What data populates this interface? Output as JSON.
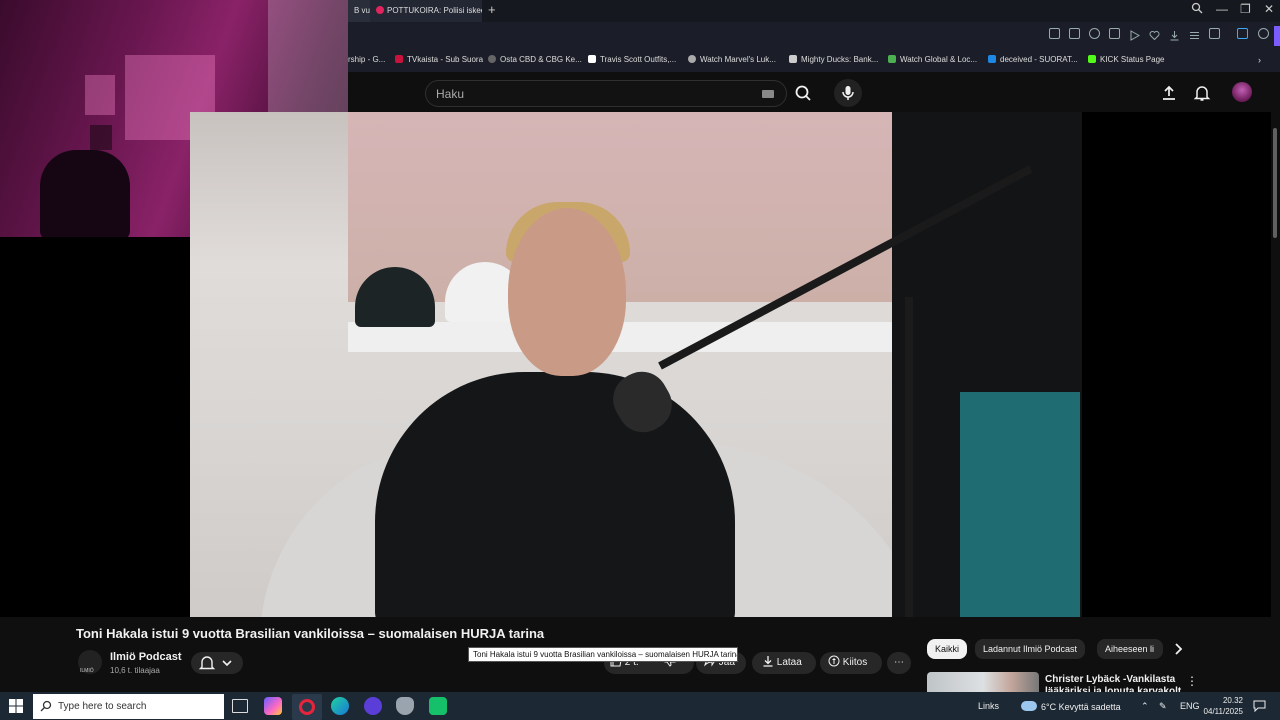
{
  "browser": {
    "tabs": [
      {
        "label": "B vu"
      },
      {
        "label": "POTTUKOIRA: Poliisi iskee"
      }
    ],
    "new_tab_label": "+",
    "window_controls": {
      "minimize": "—",
      "restore": "❐",
      "close": "✕"
    }
  },
  "bookmarks": [
    {
      "label": "rship - G..."
    },
    {
      "label": "TVkaista - Sub Suora",
      "color": "#c8143c"
    },
    {
      "label": "Osta CBD & CBG Ke...",
      "color": "#666666"
    },
    {
      "label": "Travis Scott Outfits,...",
      "color": "#ffffff"
    },
    {
      "label": "Watch Marvel's Luk...",
      "color": "#aaaaaa"
    },
    {
      "label": "Mighty Ducks: Bank...",
      "color": "#cccccc"
    },
    {
      "label": "Watch Global & Loc...",
      "color": "#4caf50"
    },
    {
      "label": "deceived - SUORAT...",
      "color": "#1e88e5"
    },
    {
      "label": "KICK Status Page",
      "color": "#53fc18"
    }
  ],
  "youtube": {
    "search_placeholder": "Haku",
    "icons": [
      "keyboard-icon",
      "search-icon",
      "mic-icon",
      "upload-icon",
      "bell-icon"
    ]
  },
  "video": {
    "title": "Toni Hakala istui 9 vuotta Brasilian vankiloissa – suomalaisen HURJA tarina",
    "tooltip": "Toni Hakala istui 9 vuotta Brasilian vankiloissa – suomalaisen HURJA tarina",
    "channel_name": "Ilmiö Podcast",
    "channel_avatar_text": "ILMIÖ",
    "subscribers": "10,6 t. tilaajaa",
    "likes": "2 t.",
    "share_label": "Jaa",
    "download_label": "Lataa",
    "thanks_label": "Kiitos",
    "more_label": "⋯"
  },
  "chips": [
    {
      "label": "Kaikki",
      "active": true
    },
    {
      "label": "Ladannut Ilmiö Podcast"
    },
    {
      "label": "Aiheeseen li"
    }
  ],
  "recommendation": {
    "title": "Christer Lybäck -Vankilasta lääkäriksi ja loputa karvakolt"
  },
  "taskbar": {
    "search_placeholder": "Type here to search",
    "weather": "6°C  Kevyttä sadetta",
    "links_label": "Links",
    "language": "ENG",
    "time": "20.32",
    "date": "04/11/2025"
  },
  "colors": {
    "youtube_bg": "#0f0f0f",
    "taskbar_bg": "#1c2833",
    "accent_purple": "#7a5cff"
  }
}
